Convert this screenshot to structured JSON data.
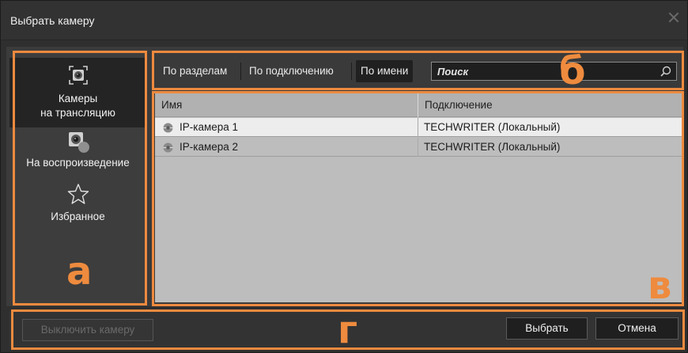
{
  "window": {
    "title": "Выбрать камеру"
  },
  "sidebar": {
    "items": [
      {
        "label_line1": "Камеры",
        "label_line2": "на трансляцию",
        "icon": "live-camera-icon",
        "active": true
      },
      {
        "label_line1": "На воспроизведение",
        "label_line2": "",
        "icon": "playback-camera-icon",
        "active": false
      },
      {
        "label_line1": "Избранное",
        "label_line2": "",
        "icon": "star-icon",
        "active": false
      }
    ]
  },
  "toolbar": {
    "tabs": [
      {
        "label": "По разделам",
        "active": false
      },
      {
        "label": "По подключению",
        "active": false
      },
      {
        "label": "По имени",
        "active": true
      }
    ],
    "search": {
      "placeholder": "Поиск",
      "value": ""
    }
  },
  "table": {
    "headers": [
      "Имя",
      "Подключение"
    ],
    "rows": [
      {
        "name": "IP-камера 1",
        "connection": "TECHWRITER (Локальный)",
        "selected": true
      },
      {
        "name": "IP-камера 2",
        "connection": "TECHWRITER (Локальный)",
        "selected": false
      }
    ]
  },
  "footer": {
    "disable_label": "Выключить камеру",
    "select_label": "Выбрать",
    "cancel_label": "Отмена"
  },
  "annotations": {
    "a": "а",
    "b": "б",
    "v": "в",
    "g": "г"
  },
  "colors": {
    "accent_orange": "#ed8a3f",
    "panel_dark": "#2f2f2f",
    "table_bg": "#bdbdbd"
  }
}
